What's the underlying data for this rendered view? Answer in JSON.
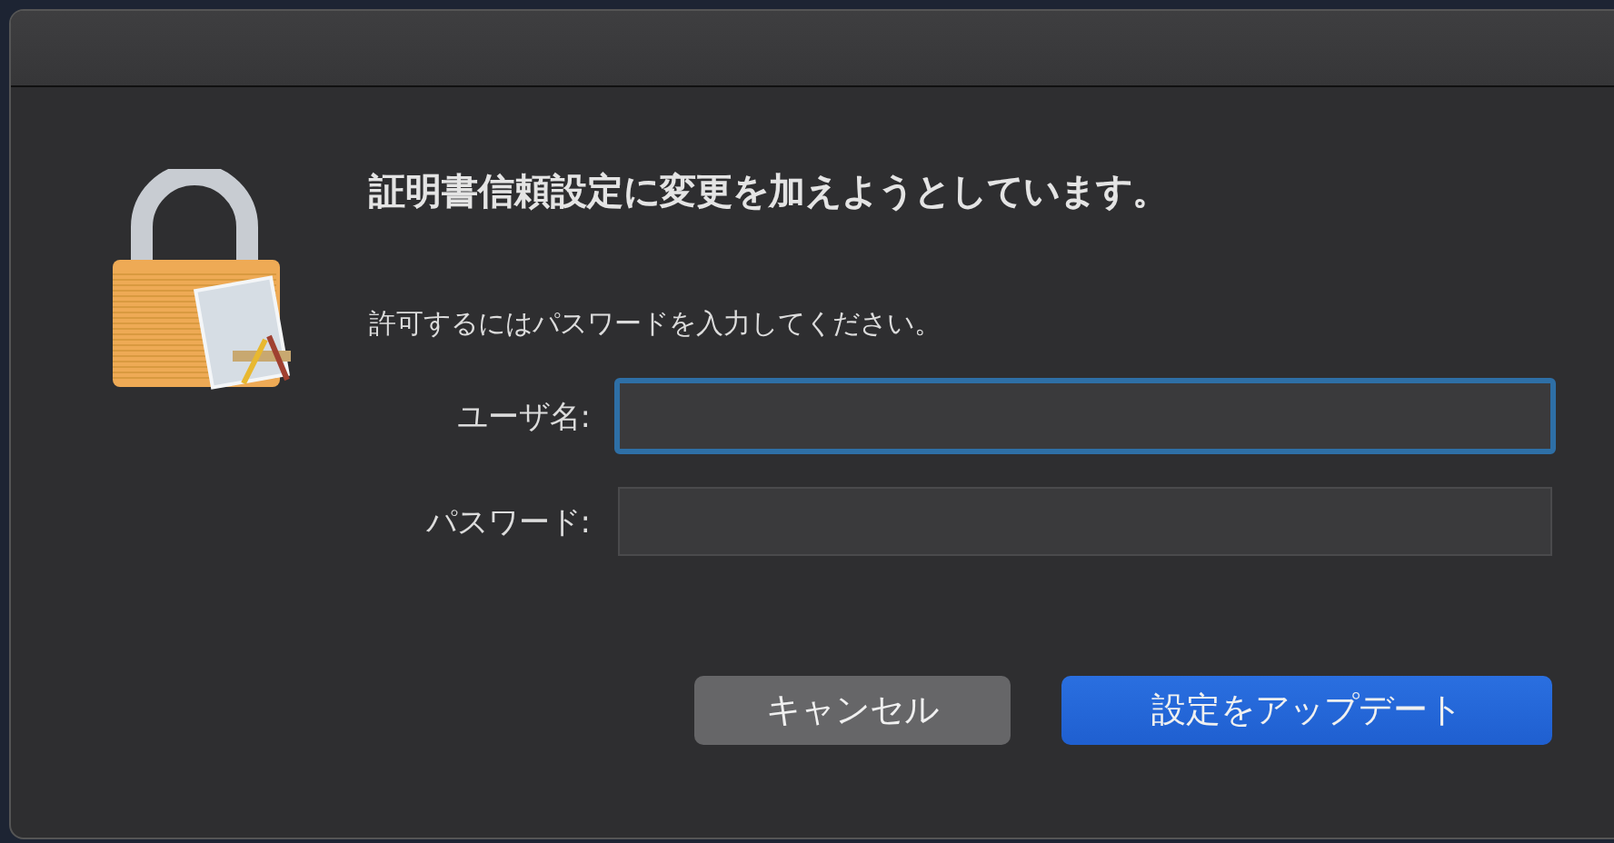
{
  "dialog": {
    "heading": "証明書信頼設定に変更を加えようとしています。",
    "message": "許可するにはパスワードを入力してください。",
    "fields": [
      {
        "label": "ユーザ名:",
        "focused": true
      },
      {
        "label": "パスワード:",
        "focused": false
      }
    ],
    "buttons": [
      {
        "label": "キャンセル",
        "kind": "normal"
      },
      {
        "label": "設定をアップデート",
        "kind": "default"
      }
    ]
  }
}
